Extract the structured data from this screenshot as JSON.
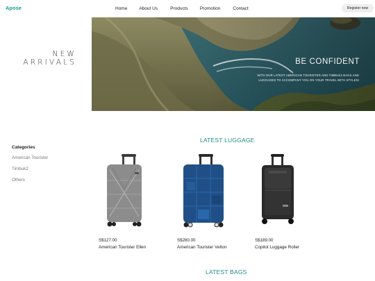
{
  "nav": {
    "brand": "Apose",
    "items": [
      "Home",
      "About Us",
      "Products",
      "Promotion",
      "Contact"
    ],
    "register_label": "Register now"
  },
  "hero": {
    "left_heading_line1": "NEW",
    "left_heading_line2": "ARRIVALS",
    "title": "BE CONFIDENT",
    "subtitle_line1": "WITH OUR LATEST AMERICAN TOURISTER AND TIMBUK2 BAGS AND",
    "subtitle_line2": "LUGGAGES TO ACCOMPANY YOU ON YOUR TRAVEL WITH STYLES!"
  },
  "sidebar": {
    "title": "Categories",
    "items": [
      "American Tourister",
      "Timbuk2",
      "Others"
    ]
  },
  "luggage": {
    "title": "LATEST LUGGAGE",
    "products": [
      {
        "price": "S$127.00",
        "name": "American Tourister Ellen",
        "color": "#8c8c8c"
      },
      {
        "price": "S$280.00",
        "name": "American Tourister Velton",
        "color": "#1f4f86"
      },
      {
        "price": "S$189.00",
        "name": "Copilot Luggage Roller",
        "color": "#2a2a2a"
      }
    ]
  },
  "bags": {
    "title": "LATEST BAGS"
  },
  "colors": {
    "accent": "#1a9a9a",
    "section_title": "#1a8a8a"
  }
}
